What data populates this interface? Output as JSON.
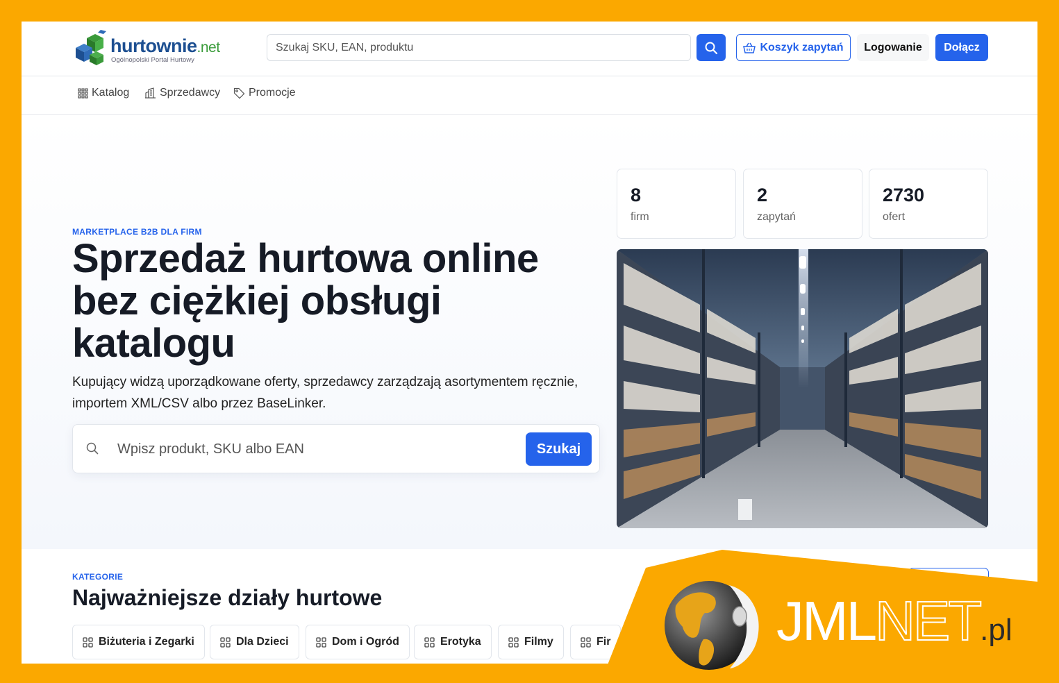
{
  "colors": {
    "accent": "#2563eb",
    "frame": "#FBA800",
    "brand_blue": "#1d4f91",
    "brand_green": "#3b9c3b"
  },
  "header": {
    "logo_name": "hurtownie",
    "logo_tld": ".net",
    "logo_tagline": "Ogólnopolski Portal Hurtowy",
    "search_placeholder": "Szukaj SKU, EAN, produktu",
    "search_icon": "search-icon",
    "cart_label": "Koszyk zapytań",
    "cart_icon": "basket-icon",
    "login_label": "Logowanie",
    "join_label": "Dołącz"
  },
  "subnav": {
    "items": [
      {
        "label": "Katalog",
        "icon": "grid-icon"
      },
      {
        "label": "Sprzedawcy",
        "icon": "building-icon"
      },
      {
        "label": "Promocje",
        "icon": "tag-icon"
      }
    ]
  },
  "hero": {
    "eyebrow": "MARKETPLACE B2B DLA FIRM",
    "title": "Sprzedaż hurtowa online bez ciężkiej obsługi katalogu",
    "description": "Kupujący widzą uporządkowane oferty, sprzedawcy zarządzają asortymentem ręcznie, importem XML/CSV albo przez BaseLinker.",
    "search_placeholder": "Wpisz produkt, SKU albo EAN",
    "search_button": "Szukaj",
    "stats": [
      {
        "value": "8",
        "label": "firm"
      },
      {
        "value": "2",
        "label": "zapytań"
      },
      {
        "value": "2730",
        "label": "ofert"
      }
    ]
  },
  "categories": {
    "eyebrow": "KATEGORIE",
    "title": "Najważniejsze działy hurtowe",
    "items": [
      {
        "label": "Biżuteria i Zegarki"
      },
      {
        "label": "Dla Dzieci"
      },
      {
        "label": "Dom i Ogród"
      },
      {
        "label": "Erotyka"
      },
      {
        "label": "Filmy"
      },
      {
        "label": "Fir"
      }
    ]
  },
  "watermark": {
    "part1": "JML",
    "part2": "NET",
    "part3": ".pl",
    "icon": "globe-icon"
  }
}
